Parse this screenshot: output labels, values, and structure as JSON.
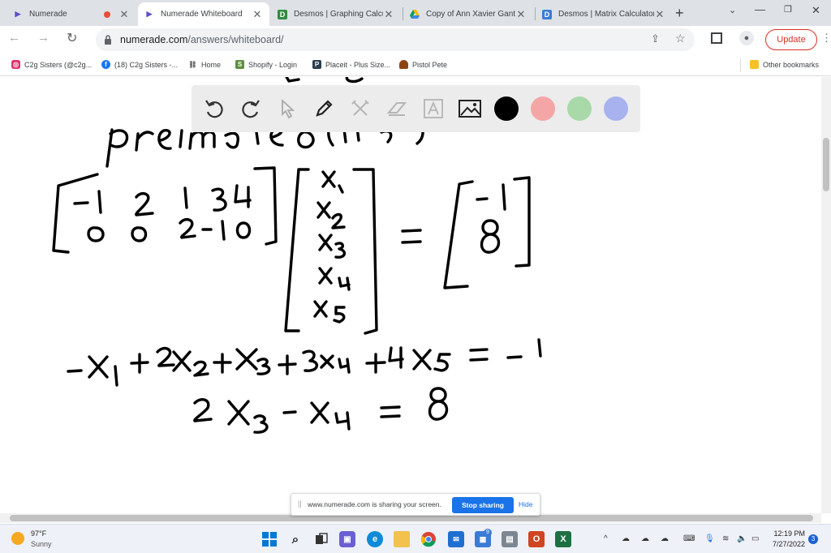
{
  "tabs": [
    {
      "title": "Numerade",
      "active": false,
      "icon": "numerade-logo-icon"
    },
    {
      "title": "Numerade Whiteboard",
      "active": true,
      "icon": "numerade-logo-icon"
    },
    {
      "title": "Desmos | Graphing Calcul",
      "active": false,
      "icon": "desmos-logo-icon"
    },
    {
      "title": "Copy of Ann Xavier Gante",
      "active": false,
      "icon": "google-drive-icon"
    },
    {
      "title": "Desmos | Matrix Calculator",
      "active": false,
      "icon": "desmos-logo-icon"
    }
  ],
  "new_tab_label": "+",
  "address": {
    "domain": "numerade.com",
    "path": "/answers/whiteboard/"
  },
  "update_label": "Update",
  "bookmarks": [
    {
      "label": "C2g Sisters (@c2g...",
      "icon": "instagram-icon",
      "color": "#e1306c"
    },
    {
      "label": "(18) C2g Sisters -...",
      "icon": "facebook-icon",
      "color": "#1877f2"
    },
    {
      "label": "Home",
      "icon": "link-icon",
      "color": "#888888"
    },
    {
      "label": "Shopify - Login",
      "icon": "shopify-icon",
      "color": "#5e8e3e"
    },
    {
      "label": "Placeit - Plus Size...",
      "icon": "placeit-icon",
      "color": "#2c3e50"
    },
    {
      "label": "Pistol Pete",
      "icon": "hat-icon",
      "color": "#8b4513"
    }
  ],
  "other_bookmarks": "Other bookmarks",
  "whiteboard": {
    "tools": [
      "undo-icon",
      "redo-icon",
      "pointer-icon",
      "pen-icon",
      "tools-icon",
      "eraser-icon",
      "text-icon",
      "image-icon"
    ],
    "colors": [
      "#000000",
      "#f4a6a6",
      "#a9d8a9",
      "#a8b2ee"
    ]
  },
  "sharing": {
    "message": "www.numerade.com is sharing your screen.",
    "stop_label": "Stop sharing",
    "hide_label": "Hide"
  },
  "taskbar": {
    "weather_temp": "97°F",
    "weather_desc": "Sunny",
    "time": "12:19 PM",
    "date": "7/27/2022",
    "notification_count": "3",
    "store_badge": "9"
  }
}
